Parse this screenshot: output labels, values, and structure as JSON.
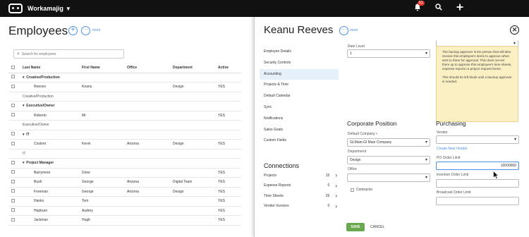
{
  "topbar": {
    "app_name": "Workamajig",
    "notification_count": "51"
  },
  "left": {
    "title": "Employees",
    "more": "more",
    "search_placeholder": "Search for employees",
    "columns": [
      "Last Name",
      "First Name",
      "Office",
      "Department",
      "Active"
    ],
    "rows": [
      {
        "kind": "group",
        "label": "Creative/Production"
      },
      {
        "kind": "row",
        "last": "Reeves",
        "first": "Keanu",
        "office": "",
        "dept": "Design",
        "active": "YES"
      },
      {
        "kind": "subgroup",
        "label": "Creative/Production"
      },
      {
        "kind": "group",
        "label": "Executive/Owner"
      },
      {
        "kind": "row",
        "last": "Roberto",
        "first": "Mr",
        "office": "",
        "dept": "",
        "active": "YES"
      },
      {
        "kind": "subgroup",
        "label": "Executive/Owner"
      },
      {
        "kind": "group",
        "label": "IT"
      },
      {
        "kind": "row",
        "last": "Costner",
        "first": "Kevin",
        "office": "Arizona",
        "dept": "Design",
        "active": "YES"
      },
      {
        "kind": "subgroup",
        "label": "IT"
      },
      {
        "kind": "group",
        "label": "Project Manager"
      },
      {
        "kind": "row",
        "last": "Barrymore",
        "first": "Drew",
        "office": "",
        "dept": "",
        "active": "YES"
      },
      {
        "kind": "row",
        "last": "Bush",
        "first": "George",
        "office": "Arizona",
        "dept": "Digital Team",
        "active": "YES"
      },
      {
        "kind": "row",
        "last": "Foreman",
        "first": "George",
        "office": "Arizona",
        "dept": "Design",
        "active": "YES"
      },
      {
        "kind": "row",
        "last": "Hanks",
        "first": "Tom",
        "office": "",
        "dept": "",
        "active": "YES"
      },
      {
        "kind": "row",
        "last": "Hepburn",
        "first": "Audrey",
        "office": "",
        "dept": "",
        "active": "YES"
      },
      {
        "kind": "row",
        "last": "Jackman",
        "first": "Hugh",
        "office": "",
        "dept": "",
        "active": "YES"
      }
    ]
  },
  "detail": {
    "name": "Keanu Reeves",
    "more": "more",
    "nav": [
      "Employee Details",
      "Security Controls",
      "Accounting",
      "Projects & Time",
      "Default Calendar",
      "Sync",
      "Notifications",
      "Sales Goals",
      "Custom Fields"
    ],
    "active_nav": "Accounting",
    "connections_title": "Connections",
    "connections": [
      {
        "label": "Projects",
        "count": "15"
      },
      {
        "label": "Expense Reports",
        "count": "0"
      },
      {
        "label": "Time Sheets",
        "count": "26"
      },
      {
        "label": "Vendor Invoices",
        "count": "0"
      }
    ],
    "rate_level_label": "Rate Level",
    "rate_level_value": "1",
    "corporate_title": "Corporate Position",
    "default_company_label": "Default Company",
    "default_company_value": "GLMain-Gl Main Company",
    "department_label": "Department",
    "department_value": "Design",
    "office_label": "Office",
    "office_value": "",
    "contractor_label": "Contractor",
    "tip_p1": "The backup approver is the person that will also receive this employee's items to approve when sent to them for approval. This does not set them up to approve this employee's time sheets, expense reports or project request forms.",
    "tip_p2": "This should be left blank until a backup approver is needed.",
    "purchasing_title": "Purchasing",
    "vendor_label": "Vendor",
    "create_vendor": "Create New Vendor",
    "po_label": "PO Order Limit",
    "po_value": "10000000",
    "insertion_label": "Insertion Order Limit",
    "broadcast_label": "Broadcast Order Limit",
    "save_label": "SAVE",
    "cancel_label": "CANCEL"
  },
  "colors": {
    "accent": "#4a90e2",
    "save": "#6aa84f",
    "tip_bg": "#fbefc4"
  }
}
